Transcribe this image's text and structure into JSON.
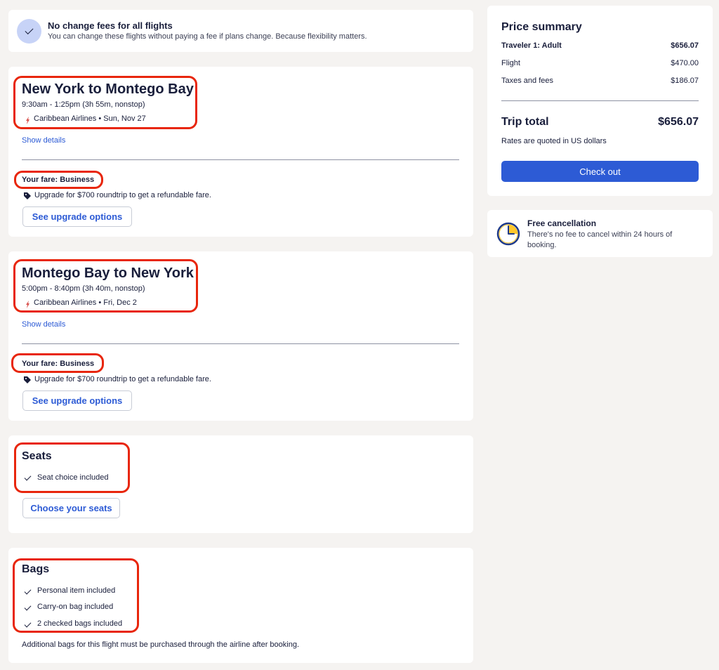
{
  "banner": {
    "title": "No change fees for all flights",
    "subtitle": "You can change these flights without paying a fee if plans change. Because flexibility matters."
  },
  "outbound": {
    "title": "New York to Montego Bay",
    "times": "9:30am - 1:25pm (3h 55m, nonstop)",
    "airline_date": "Caribbean Airlines • Sun, Nov 27",
    "details_link": "Show details",
    "fare": "Your fare: Business",
    "upgrade_text": "Upgrade for $700 roundtrip to get a refundable fare.",
    "upgrade_button": "See upgrade options"
  },
  "return": {
    "title": "Montego Bay to New York",
    "times": "5:00pm - 8:40pm (3h 40m, nonstop)",
    "airline_date": "Caribbean Airlines • Fri, Dec 2",
    "details_link": "Show details",
    "fare": "Your fare: Business",
    "upgrade_text": "Upgrade for $700 roundtrip to get a refundable fare.",
    "upgrade_button": "See upgrade options"
  },
  "seats": {
    "title": "Seats",
    "item": "Seat choice included",
    "button": "Choose your seats"
  },
  "bags": {
    "title": "Bags",
    "items": [
      "Personal item included",
      "Carry-on bag included",
      "2 checked bags included"
    ],
    "note": "Additional bags for this flight must be purchased through the airline after booking."
  },
  "price_summary": {
    "title": "Price summary",
    "traveler_label": "Traveler 1: Adult",
    "traveler_value": "$656.07",
    "flight_label": "Flight",
    "flight_value": "$470.00",
    "taxes_label": "Taxes and fees",
    "taxes_value": "$186.07",
    "total_label": "Trip total",
    "total_value": "$656.07",
    "currency_note": "Rates are quoted in US dollars",
    "checkout_button": "Check out"
  },
  "cancellation": {
    "title": "Free cancellation",
    "text_line1": "There's no fee to cancel within 24 hours of",
    "text_line2": "booking."
  },
  "colors": {
    "accent": "#2d5bd5",
    "highlight": "#e8260c",
    "background": "#f5f3f1"
  }
}
